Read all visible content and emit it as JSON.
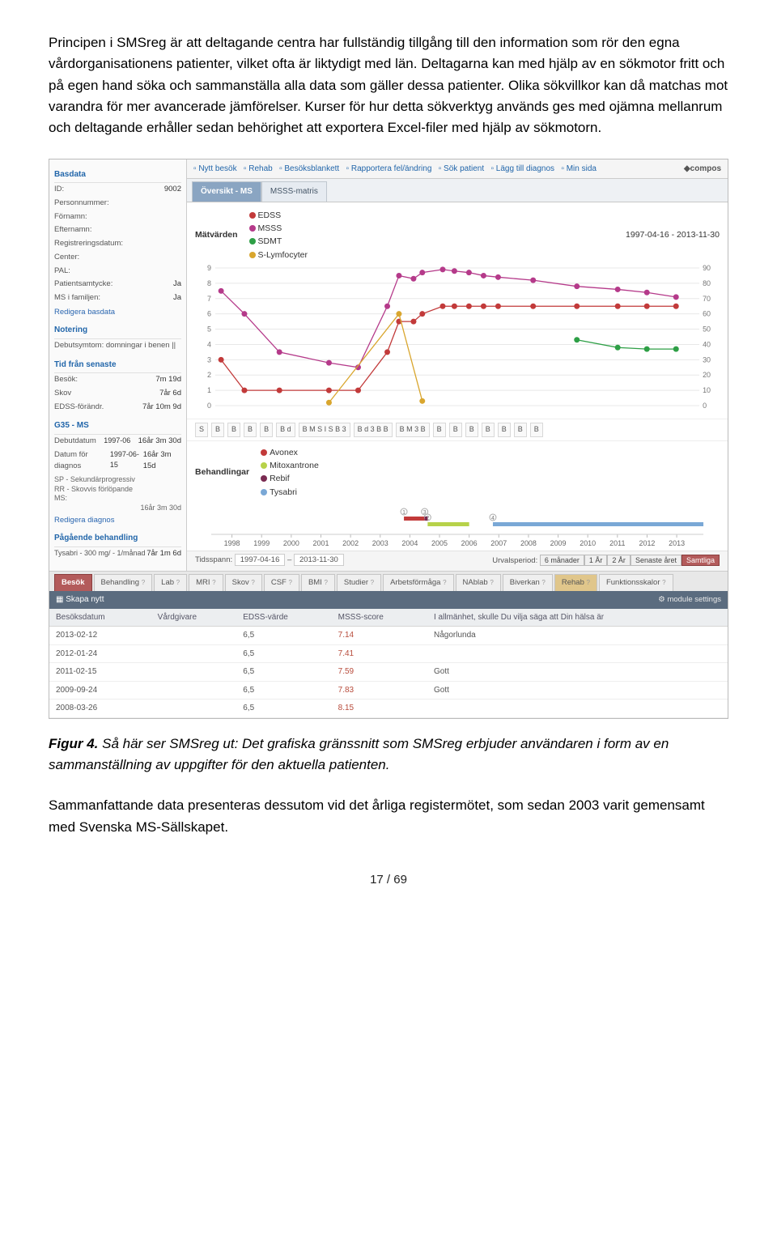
{
  "para1": "Principen i SMSreg är att deltagande centra har fullständig tillgång till den information som rör den egna vårdorganisationens patienter, vilket ofta är liktydigt med län. Deltagarna kan med hjälp av en sökmotor fritt och på egen hand söka och sammanställa alla data som gäller dessa patienter. Olika sökvillkor kan då matchas mot varandra för mer avancerade jämförelser. Kurser för hur detta sökverktyg används ges med ojämna mellanrum och deltagande erhåller sedan behörighet att exportera Excel-filer med hjälp av sökmotorn.",
  "figure": {
    "side": {
      "basdata": {
        "title": "Basdata",
        "rows_left": [
          "ID:",
          "Personnummer:",
          "Förnamn:",
          "Efternamn:",
          "Registreringsdatum:",
          "Center:",
          "PAL:",
          "Patientsamtycke:",
          "MS i familjen:"
        ],
        "rows_right": [
          "9002",
          "",
          "",
          "",
          "",
          "",
          "",
          "Ja",
          "Ja"
        ],
        "edit": "Redigera basdata"
      },
      "notering": {
        "title": "Notering",
        "text": "Debutsymtom: domningar i benen ||"
      },
      "tid": {
        "title": "Tid från senaste",
        "rows": [
          {
            "l": "Besök:",
            "r": "7m 19d"
          },
          {
            "l": "Skov",
            "r": "7år 6d"
          },
          {
            "l": "EDSS-förändr.",
            "r": "7år 10m 9d"
          }
        ]
      },
      "g35": {
        "title": "G35 - MS",
        "rows": [
          {
            "l": "Debutdatum",
            "m": "1997-06",
            "r": "16år 3m 30d"
          },
          {
            "l": "Datum för diagnos",
            "m": "1997-06-15",
            "r": "16år 3m 15d"
          }
        ],
        "extra_l": [
          "SP - Sekundärprogressiv",
          "RR - Skovvis förlöpande",
          "MS:"
        ],
        "extra_r": "16år 3m 30d",
        "edit": "Redigera diagnos"
      },
      "pag": {
        "title": "Pågående behandling",
        "rows": [
          {
            "l": "Tysabri - 300 mg/ - 1/månad",
            "r": "7år 1m 6d"
          }
        ]
      }
    },
    "toolbar": {
      "items": [
        "Nytt besök",
        "Rehab",
        "Besöksblankett",
        "Rapportera fel/ändring",
        "Sök patient",
        "Lägg till diagnos",
        "Min sida"
      ],
      "brand": "◆compos"
    },
    "ov_tabs": [
      "Översikt - MS",
      "MSSS-matris"
    ],
    "chart_head": {
      "title": "Mätvärden",
      "legend": [
        {
          "name": "EDSS",
          "color": "#c23a3a"
        },
        {
          "name": "MSSS",
          "color": "#b53a8a"
        },
        {
          "name": "SDMT",
          "color": "#2e9f46"
        },
        {
          "name": "S-Lymfocyter",
          "color": "#d9a62e"
        }
      ],
      "range": "1997-04-16 - 2013-11-30"
    },
    "b_row": [
      "S",
      "B",
      "B",
      "B",
      "B",
      "B d",
      "B M S I S B 3",
      "B d 3 B B",
      "B M 3 B",
      "B",
      "B",
      "B",
      "B",
      "B",
      "B",
      "B"
    ],
    "beh": {
      "title": "Behandlingar",
      "legend": [
        {
          "name": "Avonex",
          "color": "#c23a3a"
        },
        {
          "name": "Mitoxantrone",
          "color": "#b7d24a"
        },
        {
          "name": "Rebif",
          "color": "#7a2b52"
        },
        {
          "name": "Tysabri",
          "color": "#7aa8d6"
        }
      ],
      "years": [
        "1998",
        "1999",
        "2000",
        "2001",
        "2002",
        "2003",
        "2004",
        "2005",
        "2006",
        "2007",
        "2008",
        "2009",
        "2010",
        "2011",
        "2012",
        "2013"
      ]
    },
    "timerow": {
      "tlabel": "Tidsspann:",
      "t1": "1997-04-16",
      "t2": "2013-11-30",
      "ulabel": "Urvalsperiod:",
      "buttons": [
        "6 månader",
        "1 År",
        "2 År",
        "Senaste året",
        "Samtliga"
      ],
      "selected": 4
    },
    "bottom_tabs": [
      "Besök",
      "Behandling",
      "Lab",
      "MRI",
      "Skov",
      "CSF",
      "BMI",
      "Studier",
      "Arbetsförmåga",
      "NAblab",
      "Biverkan",
      "Rehab",
      "Funktionsskalor"
    ],
    "skapa": {
      "label": "Skapa nytt",
      "right": "module settings"
    },
    "table": {
      "headers": [
        "Besöksdatum",
        "Vårdgivare",
        "EDSS-värde",
        "MSSS-score",
        "I allmänhet, skulle Du vilja säga att Din hälsa är"
      ],
      "rows": [
        [
          "2013-02-12",
          "",
          "6,5",
          "7.14",
          "Någorlunda"
        ],
        [
          "2012-01-24",
          "",
          "6,5",
          "7.41",
          ""
        ],
        [
          "2011-02-15",
          "",
          "6,5",
          "7.59",
          "Gott"
        ],
        [
          "2009-09-24",
          "",
          "6,5",
          "7.83",
          "Gott"
        ],
        [
          "2008-03-26",
          "",
          "6,5",
          "8.15",
          ""
        ]
      ]
    }
  },
  "chart_data": {
    "type": "line",
    "x_range": [
      1997.3,
      2013.9
    ],
    "left_axis": {
      "ticks": [
        0,
        1,
        2,
        3,
        4,
        5,
        6,
        7,
        8,
        9
      ]
    },
    "right_axis": {
      "ticks": [
        0,
        10,
        20,
        30,
        40,
        50,
        60,
        70,
        80,
        90
      ]
    },
    "series": [
      {
        "name": "EDSS",
        "axis": "left",
        "color": "#c23a3a",
        "points": [
          [
            1997.5,
            3
          ],
          [
            1998.3,
            1
          ],
          [
            1999.5,
            1
          ],
          [
            2001.2,
            1
          ],
          [
            2002.2,
            1
          ],
          [
            2003.2,
            3.5
          ],
          [
            2003.6,
            5.5
          ],
          [
            2004.1,
            5.5
          ],
          [
            2004.4,
            6
          ],
          [
            2005.1,
            6.5
          ],
          [
            2005.5,
            6.5
          ],
          [
            2006.0,
            6.5
          ],
          [
            2006.5,
            6.5
          ],
          [
            2007.0,
            6.5
          ],
          [
            2008.2,
            6.5
          ],
          [
            2009.7,
            6.5
          ],
          [
            2011.1,
            6.5
          ],
          [
            2012.1,
            6.5
          ],
          [
            2013.1,
            6.5
          ]
        ]
      },
      {
        "name": "MSSS",
        "axis": "left",
        "color": "#b53a8a",
        "points": [
          [
            1997.5,
            7.5
          ],
          [
            1998.3,
            6
          ],
          [
            1999.5,
            3.5
          ],
          [
            2001.2,
            2.8
          ],
          [
            2002.2,
            2.5
          ],
          [
            2003.2,
            6.5
          ],
          [
            2003.6,
            8.5
          ],
          [
            2004.1,
            8.3
          ],
          [
            2004.4,
            8.7
          ],
          [
            2005.1,
            8.9
          ],
          [
            2005.5,
            8.8
          ],
          [
            2006.0,
            8.7
          ],
          [
            2006.5,
            8.5
          ],
          [
            2007.0,
            8.4
          ],
          [
            2008.2,
            8.2
          ],
          [
            2009.7,
            7.8
          ],
          [
            2011.1,
            7.6
          ],
          [
            2012.1,
            7.4
          ],
          [
            2013.1,
            7.1
          ]
        ]
      },
      {
        "name": "SDMT",
        "axis": "right",
        "color": "#2e9f46",
        "points": [
          [
            2009.7,
            43
          ],
          [
            2011.1,
            38
          ],
          [
            2012.1,
            37
          ],
          [
            2013.1,
            37
          ]
        ]
      },
      {
        "name": "S-Lymfocyter",
        "axis": "left",
        "color": "#d9a62e",
        "points": [
          [
            2001.2,
            0.2
          ],
          [
            2003.6,
            6
          ],
          [
            2004.4,
            0.3
          ]
        ]
      }
    ],
    "treatments": [
      {
        "name": "Avonex",
        "color": "#c23a3a",
        "start": 2003.8,
        "end": 2004.5
      },
      {
        "name": "Mitoxantrone",
        "color": "#b7d24a",
        "start": 2004.6,
        "end": 2006.0
      },
      {
        "name": "Rebif",
        "color": "#7a2b52",
        "start": 2004.5,
        "end": 2004.6
      },
      {
        "name": "Tysabri",
        "color": "#7aa8d6",
        "start": 2006.8,
        "end": 2013.9
      }
    ]
  },
  "caption_num": "Figur 4.",
  "caption_txt": " Så här ser SMSreg ut: Det grafiska gränssnitt som SMSreg erbjuder användaren i form av en sammanställning av uppgifter för den aktuella patienten.",
  "para2": "Sammanfattande data presenteras dessutom vid det årliga registermötet, som sedan 2003 varit gemensamt med Svenska MS-Sällskapet.",
  "page": "17 / 69"
}
